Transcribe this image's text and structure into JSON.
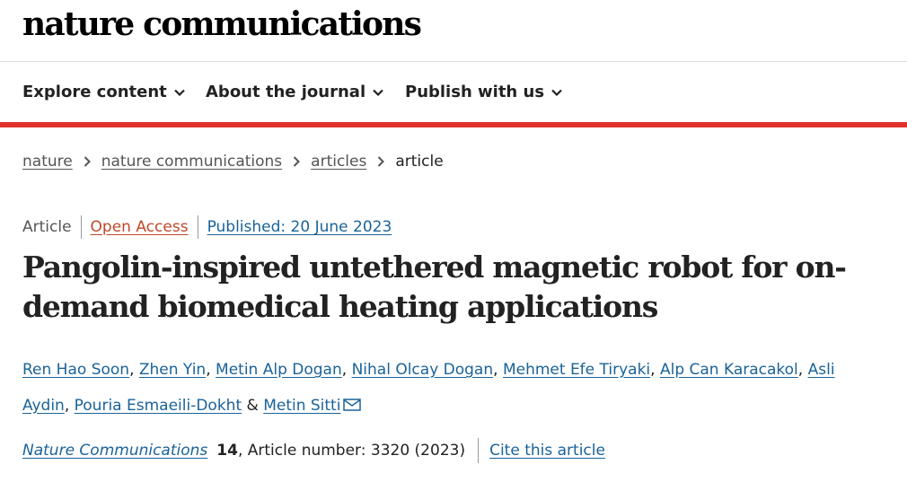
{
  "site": {
    "logo_text": "nature communications"
  },
  "nav": {
    "items": [
      {
        "label": "Explore content",
        "icon": "chevron-down-icon"
      },
      {
        "label": "About the journal",
        "icon": "chevron-down-icon"
      },
      {
        "label": "Publish with us",
        "icon": "chevron-down-icon"
      }
    ],
    "accent_color": "#e0312d"
  },
  "breadcrumb": {
    "items": [
      "nature",
      "nature communications",
      "articles"
    ],
    "current": "article",
    "separator_icon": "chevron-right-icon"
  },
  "article": {
    "type": "Article",
    "access": "Open Access",
    "published": "Published: 20 June 2023",
    "title": "Pangolin-inspired untethered magnetic robot for on-demand biomedical heating applications",
    "authors": [
      "Ren Hao Soon",
      "Zhen Yin",
      "Metin Alp Dogan",
      "Nihal Olcay Dogan",
      "Mehmet Efe Tiryaki",
      "Alp Can Karacakol",
      "Asli Aydin",
      "Pouria Esmaeili-Dokht",
      "Metin Sitti"
    ],
    "corresponding_icon": "mail-icon",
    "citation": {
      "journal": "Nature Communications",
      "volume": "14",
      "article_number": ", Article number: 3320 (2023)",
      "cite_label": "Cite this article"
    }
  }
}
